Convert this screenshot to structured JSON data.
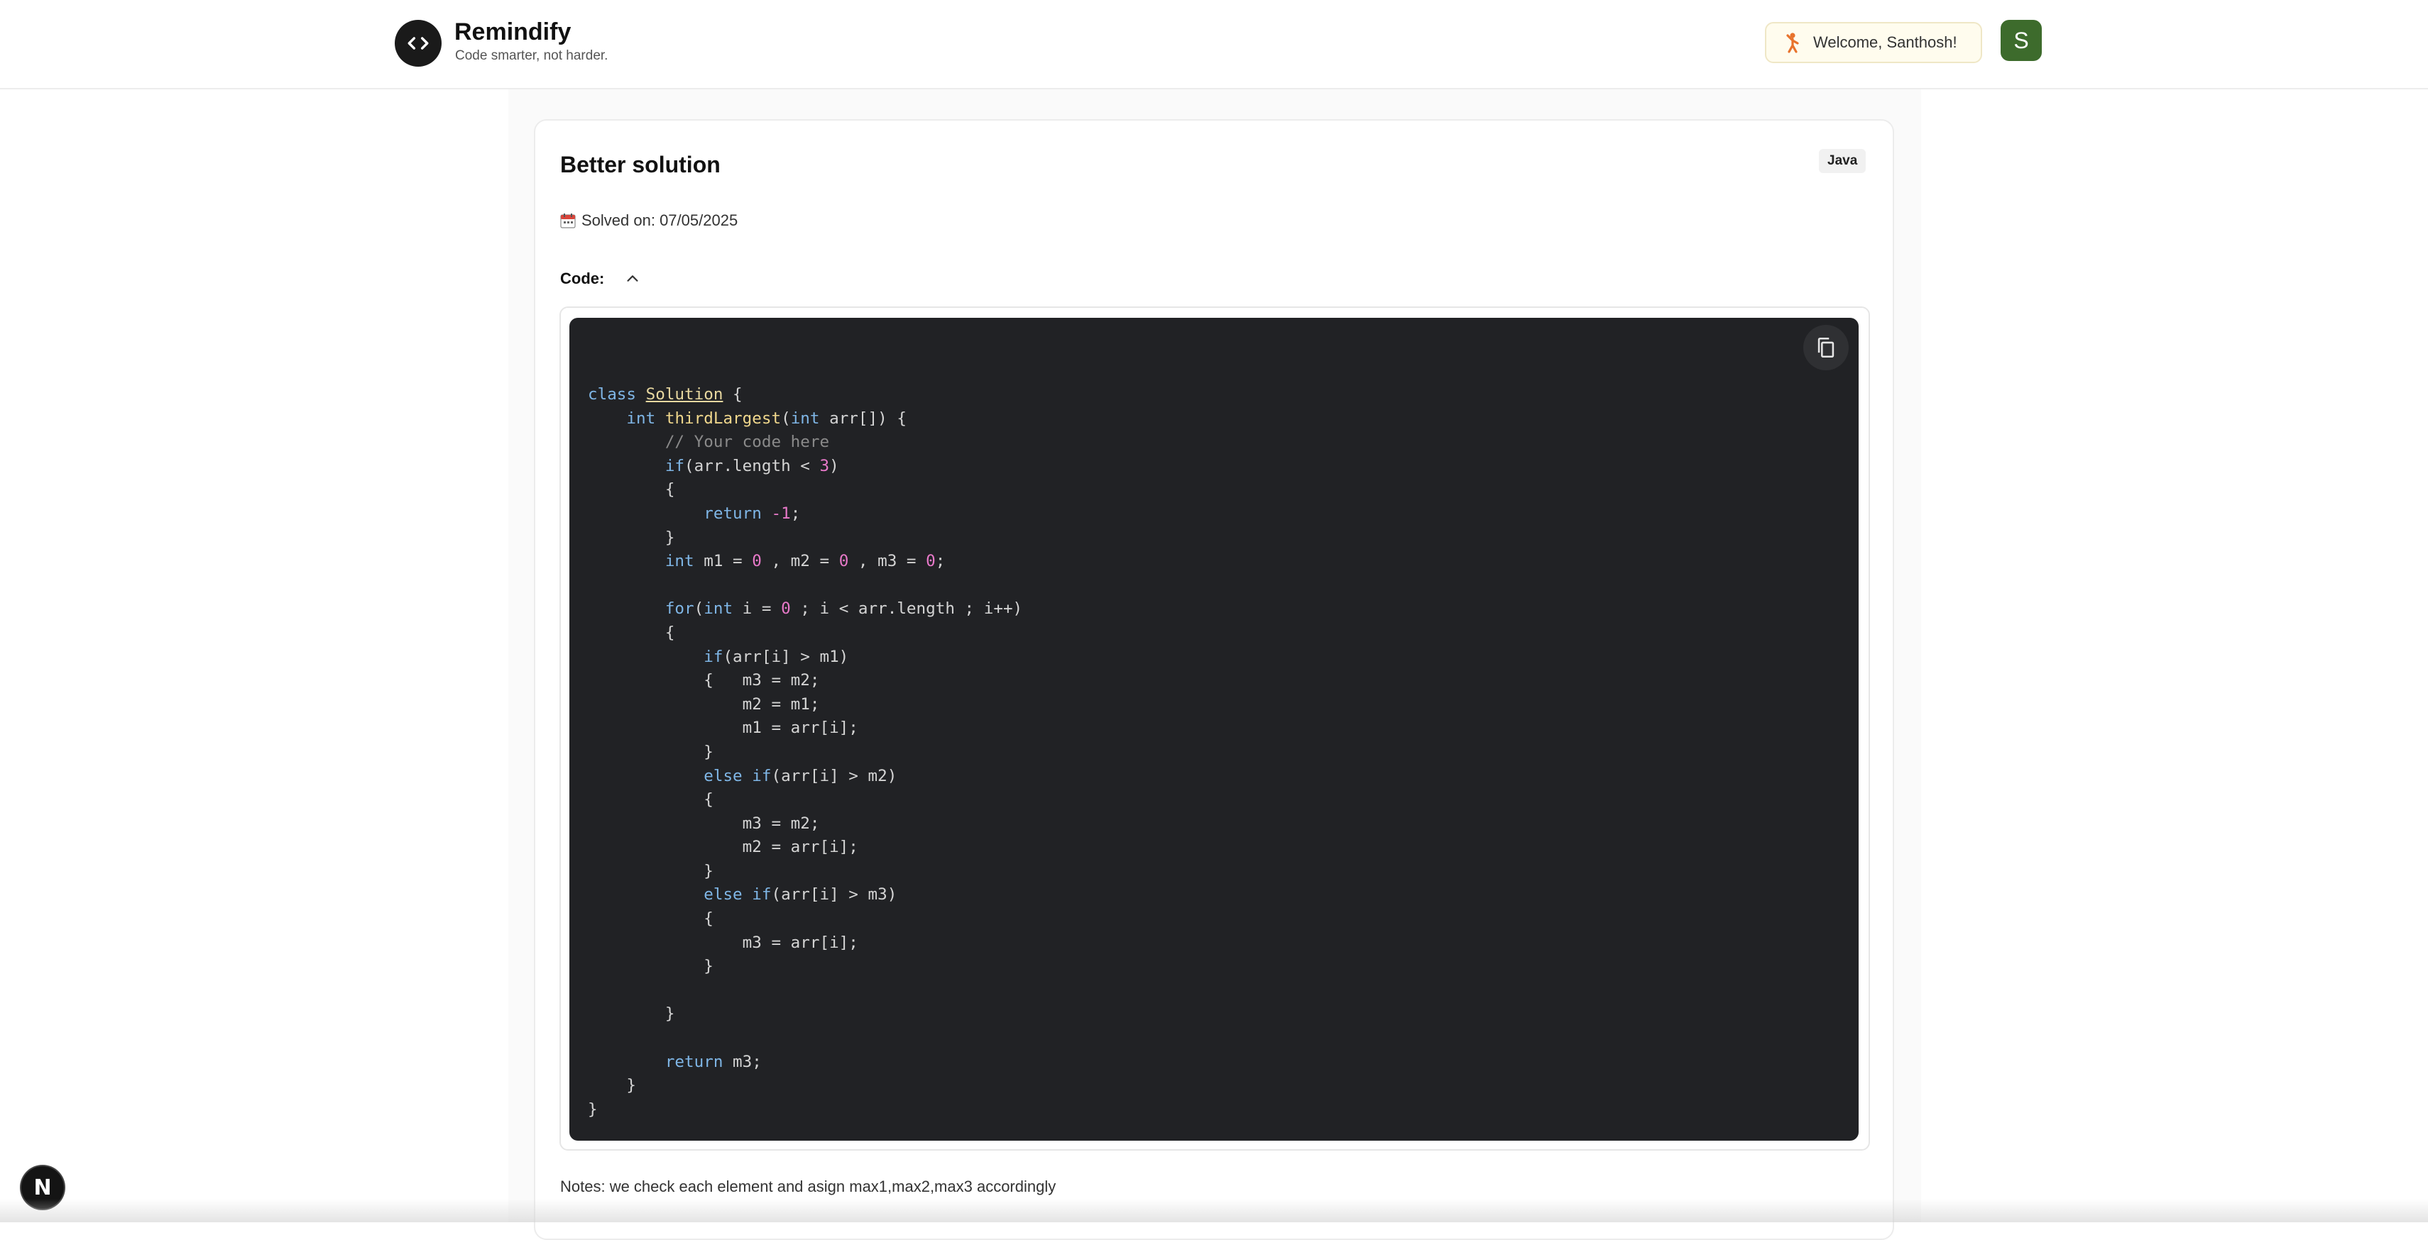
{
  "header": {
    "brand_name": "Remindify",
    "brand_tagline": "Code smarter, not harder.",
    "welcome_text": "Welcome, Santhosh!",
    "avatar_initial": "S"
  },
  "solution": {
    "title": "Better solution",
    "language": "Java",
    "solved_on": "Solved on: 07/05/2025",
    "code_label": "Code:",
    "code_lines": [
      "class Solution {",
      "    int thirdLargest(int arr[]) {",
      "        // Your code here",
      "        if(arr.length < 3)",
      "        {",
      "            return -1;",
      "        }",
      "        int m1 = 0 , m2 = 0 , m3 = 0;",
      "",
      "        for(int i = 0 ; i < arr.length ; i++)",
      "        {",
      "            if(arr[i] > m1)",
      "            {   m3 = m2;",
      "                m2 = m1;",
      "                m1 = arr[i];",
      "            }",
      "            else if(arr[i] > m2)",
      "            {",
      "                m3 = m2;",
      "                m2 = arr[i];",
      "            }",
      "            else if(arr[i] > m3)",
      "            {",
      "                m3 = arr[i];",
      "            }",
      "",
      "        }",
      "",
      "        return m3;",
      "    }",
      "}"
    ],
    "notes": "Notes: we check each element and asign max1,max2,max3 accordingly"
  },
  "dev_badge": "N",
  "colors": {
    "avatar_bg": "#3d6b2c",
    "code_bg": "#212225",
    "keyword": "#7fb6e6",
    "function": "#f0d78c",
    "number": "#e879c9",
    "comment": "#8a8a8a"
  },
  "icons": [
    "code-brackets-icon",
    "waving-person-icon",
    "calendar-icon",
    "chevron-up-icon",
    "copy-icon"
  ]
}
